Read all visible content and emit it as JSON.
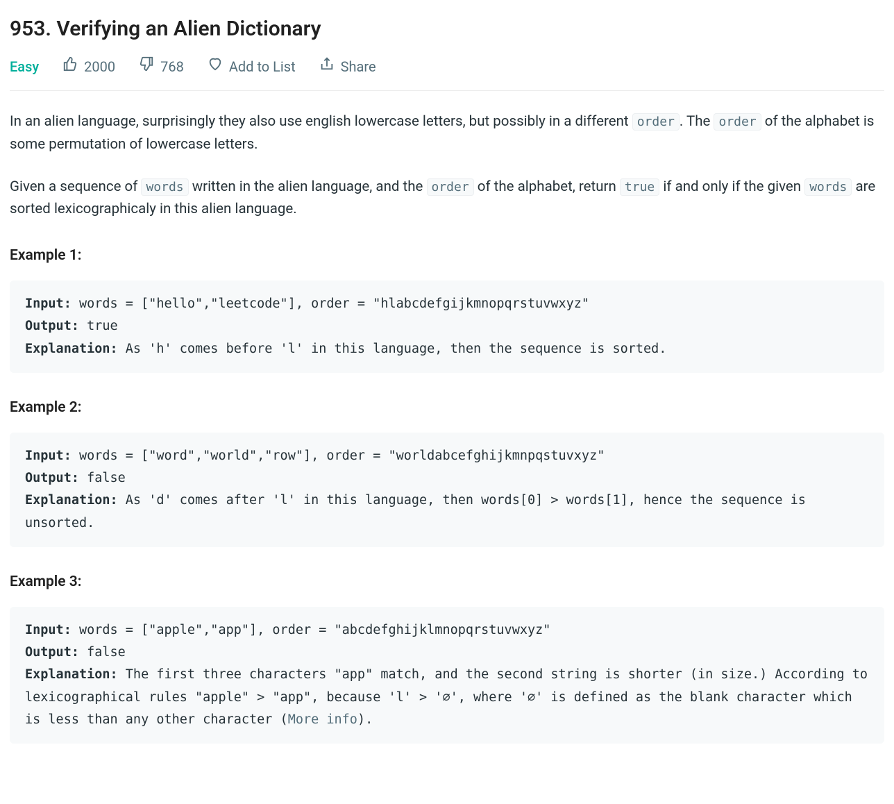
{
  "title": "953. Verifying an Alien Dictionary",
  "meta": {
    "difficulty": "Easy",
    "likes": "2000",
    "dislikes": "768",
    "add_to_list": "Add to List",
    "share": "Share"
  },
  "description": {
    "p1_a": "In an alien language, surprisingly they also use english lowercase letters, but possibly in a different ",
    "code1": "order",
    "p1_b": ". The ",
    "code2": "order",
    "p1_c": " of the alphabet is some permutation of lowercase letters.",
    "p2_a": "Given a sequence of ",
    "code3": "words",
    "p2_b": " written in the alien language, and the ",
    "code4": "order",
    "p2_c": " of the alphabet, return ",
    "code5": "true",
    "p2_d": " if and only if the given ",
    "code6": "words",
    "p2_e": " are sorted lexicographicaly in this alien language."
  },
  "labels": {
    "input": "Input:",
    "output": "Output:",
    "explanation": "Explanation:"
  },
  "examples": [
    {
      "heading": "Example 1:",
      "input": " words = [\"hello\",\"leetcode\"], order = \"hlabcdefgijkmnopqrstuvwxyz\"",
      "output": " true",
      "explanation": " As 'h' comes before 'l' in this language, then the sequence is sorted."
    },
    {
      "heading": "Example 2:",
      "input": " words = [\"word\",\"world\",\"row\"], order = \"worldabcefghijkmnpqstuvxyz\"",
      "output": " false",
      "explanation": " As 'd' comes after 'l' in this language, then words[0] > words[1], hence the sequence is unsorted."
    },
    {
      "heading": "Example 3:",
      "input": " words = [\"apple\",\"app\"], order = \"abcdefghijklmnopqrstuvwxyz\"",
      "output": " false",
      "explanation_a": " The first three characters \"app\" match, and the second string is shorter (in size.) According to lexicographical rules \"apple\" > \"app\", because 'l' > '∅', where '∅' is defined as the blank character which is less than any other character (",
      "link_text": "More info",
      "explanation_b": ")."
    }
  ]
}
